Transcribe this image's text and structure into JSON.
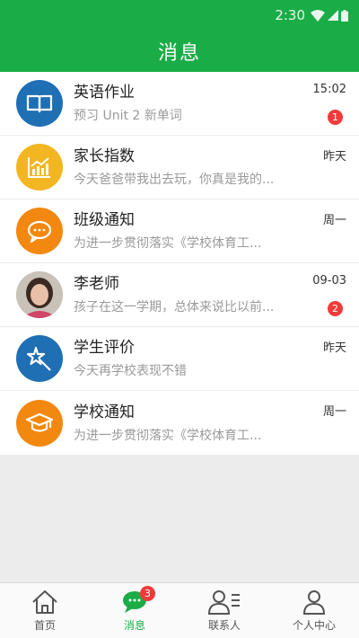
{
  "status_bar": {
    "time": "2:30"
  },
  "header": {
    "title": "消息"
  },
  "messages": [
    {
      "name": "英语作业",
      "preview": "预习 Unit 2 新单词",
      "time": "15:02",
      "badge": "1",
      "icon": "book-icon",
      "color": "#1f6fb4"
    },
    {
      "name": "家长指数",
      "preview": "今天爸爸带我出去玩，你真是我的...",
      "time": "昨天",
      "icon": "chart-icon",
      "color": "#f2b623"
    },
    {
      "name": "班级通知",
      "preview": "为进一步贯彻落实《学校体育工...",
      "time": "周一",
      "icon": "chat-bubble-icon",
      "color": "#f2880f"
    },
    {
      "name": "李老师",
      "preview": "孩子在这一学期，总体来说比以前...",
      "time": "09-03",
      "badge": "2",
      "icon": "teacher-photo"
    },
    {
      "name": "学生评价",
      "preview": "今天再学校表现不错",
      "time": "昨天",
      "icon": "magic-wand-icon",
      "color": "#1f6fb4"
    },
    {
      "name": "学校通知",
      "preview": "为进一步贯彻落实《学校体育工...",
      "time": "周一",
      "icon": "graduation-cap-icon",
      "color": "#f2880f"
    }
  ],
  "tabs": [
    {
      "label": "首页",
      "icon": "home-icon"
    },
    {
      "label": "消息",
      "icon": "message-icon",
      "badge": "3",
      "active": true
    },
    {
      "label": "联系人",
      "icon": "contacts-icon"
    },
    {
      "label": "个人中心",
      "icon": "user-icon"
    }
  ],
  "colors": {
    "brand": "#1aad47",
    "badge": "#ef3b3b"
  }
}
